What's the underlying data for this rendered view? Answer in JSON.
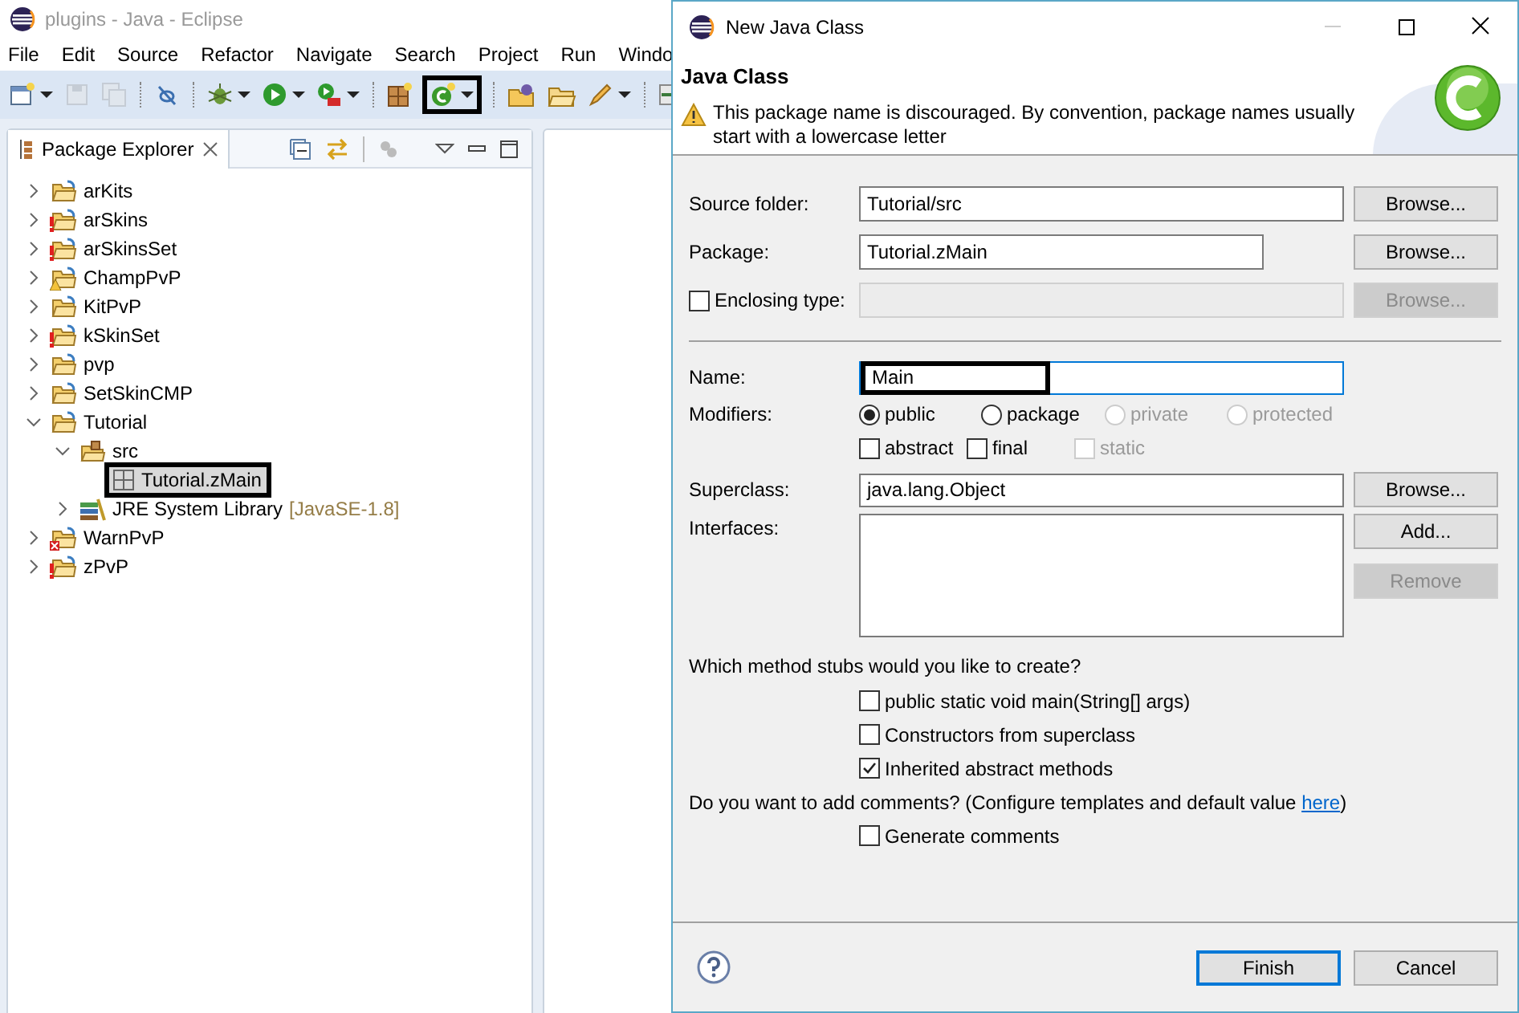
{
  "window": {
    "title": "plugins - Java - Eclipse"
  },
  "menu": [
    "File",
    "Edit",
    "Source",
    "Refactor",
    "Navigate",
    "Search",
    "Project",
    "Run",
    "Windo"
  ],
  "toolbar": [
    {
      "items": [
        {
          "kind": "new",
          "dropdown": true,
          "disabled": false,
          "highlighted": false
        },
        {
          "kind": "save",
          "dropdown": false,
          "disabled": true,
          "highlighted": false
        },
        {
          "kind": "save-all",
          "dropdown": false,
          "disabled": true,
          "highlighted": false
        }
      ]
    },
    {
      "items": [
        {
          "kind": "skip",
          "dropdown": false,
          "disabled": false,
          "highlighted": false
        }
      ]
    },
    {
      "items": [
        {
          "kind": "debug",
          "dropdown": true,
          "disabled": false,
          "highlighted": false
        },
        {
          "kind": "run",
          "dropdown": true,
          "disabled": false,
          "highlighted": false
        },
        {
          "kind": "external",
          "dropdown": true,
          "disabled": false,
          "highlighted": false
        }
      ]
    },
    {
      "items": [
        {
          "kind": "new-package",
          "dropdown": false,
          "disabled": false,
          "highlighted": false
        },
        {
          "kind": "new-class",
          "dropdown": true,
          "disabled": false,
          "highlighted": true
        }
      ]
    },
    {
      "items": [
        {
          "kind": "open-type",
          "dropdown": false,
          "disabled": false,
          "highlighted": false
        },
        {
          "kind": "open-folder",
          "dropdown": false,
          "disabled": false,
          "highlighted": false
        },
        {
          "kind": "pen",
          "dropdown": true,
          "disabled": false,
          "highlighted": false
        }
      ]
    },
    {
      "items": [
        {
          "kind": "import",
          "dropdown": false,
          "disabled": false,
          "highlighted": false
        }
      ]
    }
  ],
  "explorer": {
    "title": "Package Explorer",
    "tree": [
      {
        "label": "arKits",
        "kind": "project",
        "expanded": false
      },
      {
        "label": "arSkins",
        "kind": "project-error",
        "expanded": false
      },
      {
        "label": "arSkinsSet",
        "kind": "project-error",
        "expanded": false
      },
      {
        "label": "ChampPvP",
        "kind": "project-warning",
        "expanded": false
      },
      {
        "label": "KitPvP",
        "kind": "project",
        "expanded": false
      },
      {
        "label": "kSkinSet",
        "kind": "project-error",
        "expanded": false
      },
      {
        "label": "pvp",
        "kind": "project",
        "expanded": false
      },
      {
        "label": "SetSkinCMP",
        "kind": "project",
        "expanded": false
      },
      {
        "label": "Tutorial",
        "kind": "project",
        "expanded": true,
        "children": [
          {
            "label": "src",
            "kind": "source-folder",
            "expanded": true,
            "children": [
              {
                "label": "Tutorial.zMain",
                "kind": "package",
                "selected": true,
                "highlighted": true
              }
            ]
          },
          {
            "label": "JRE System Library",
            "detail": "[JavaSE-1.8]",
            "kind": "library",
            "expanded": false
          }
        ]
      },
      {
        "label": "WarnPvP",
        "kind": "project-broken",
        "expanded": false
      },
      {
        "label": "zPvP",
        "kind": "project-error",
        "expanded": false
      }
    ]
  },
  "dialog": {
    "title": "New Java Class",
    "heading": "Java Class",
    "message": "This package name is discouraged. By convention, package names usually start with a lowercase letter",
    "source_folder": {
      "label": "Source folder:",
      "value": "Tutorial/src",
      "button": "Browse..."
    },
    "package": {
      "label": "Package:",
      "value": "Tutorial.zMain",
      "button": "Browse..."
    },
    "enclosing_type": {
      "label": "Enclosing type:",
      "checked": false,
      "button": "Browse...",
      "disabled": true
    },
    "name": {
      "label": "Name:",
      "value": "Main",
      "highlighted": true
    },
    "modifiers": {
      "label": "Modifiers:",
      "radios": [
        {
          "label": "public",
          "selected": true,
          "disabled": false
        },
        {
          "label": "package",
          "selected": false,
          "disabled": false
        },
        {
          "label": "private",
          "selected": false,
          "disabled": true
        },
        {
          "label": "protected",
          "selected": false,
          "disabled": true
        }
      ],
      "checkboxes": [
        {
          "label": "abstract",
          "checked": false,
          "disabled": false
        },
        {
          "label": "final",
          "checked": false,
          "disabled": false
        },
        {
          "label": "static",
          "checked": false,
          "disabled": true
        }
      ]
    },
    "superclass": {
      "label": "Superclass:",
      "value": "java.lang.Object",
      "button": "Browse..."
    },
    "interfaces": {
      "label": "Interfaces:",
      "buttons": [
        {
          "label": "Add...",
          "disabled": false
        },
        {
          "label": "Remove",
          "disabled": true
        }
      ]
    },
    "stubs_question": "Which method stubs would you like to create?",
    "stubs": [
      {
        "label": "public static void main(String[] args)",
        "checked": false
      },
      {
        "label": "Constructors from superclass",
        "checked": false
      },
      {
        "label": "Inherited abstract methods",
        "checked": true
      }
    ],
    "comments_question": "Do you want to add comments? (Configure templates and default value ",
    "comments_link": "here",
    "comments_end": ")",
    "generate_comments": {
      "label": "Generate comments",
      "checked": false
    },
    "buttons": [
      {
        "label": "Finish",
        "default": true
      },
      {
        "label": "Cancel",
        "default": false
      }
    ]
  }
}
